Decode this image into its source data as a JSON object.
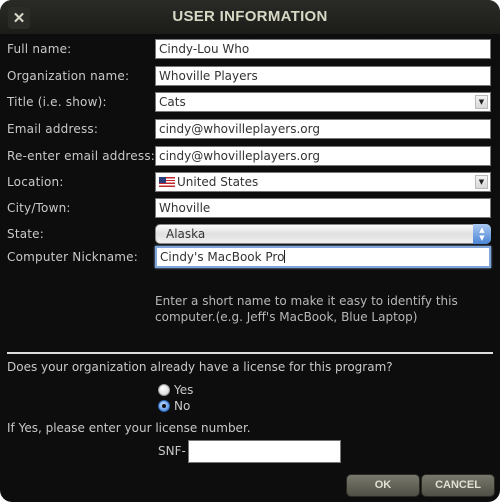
{
  "dialog": {
    "title": "USER INFORMATION",
    "close_icon": "close-x-icon"
  },
  "form": {
    "full_name": {
      "label": "Full name:",
      "value": "Cindy-Lou Who"
    },
    "organization": {
      "label": "Organization name:",
      "value": "Whoville Players"
    },
    "title_show": {
      "label": "Title (i.e. show):",
      "value": "Cats"
    },
    "email": {
      "label": "Email address:",
      "value": "cindy@whovilleplayers.org"
    },
    "email_confirm": {
      "label": "Re-enter email address:",
      "value": "cindy@whovilleplayers.org"
    },
    "location": {
      "label": "Location:",
      "value": "United States",
      "icon": "us-flag-icon"
    },
    "city": {
      "label": "City/Town:",
      "value": "Whoville"
    },
    "state": {
      "label": "State:",
      "value": "Alaska"
    },
    "nickname": {
      "label": "Computer Nickname:",
      "value": "Cindy's MacBook Pro"
    },
    "nickname_help": "Enter a short name to make it easy to identify this computer.(e.g. Jeff's MacBook, Blue Laptop)"
  },
  "license": {
    "question": "Does your organization already have a license for this program?",
    "options": [
      {
        "label": "Yes",
        "selected": false
      },
      {
        "label": "No",
        "selected": true
      }
    ],
    "prompt": "If Yes, please enter your license number.",
    "prefix": "SNF-",
    "value": ""
  },
  "buttons": {
    "ok": "OK",
    "cancel": "CANCEL"
  }
}
